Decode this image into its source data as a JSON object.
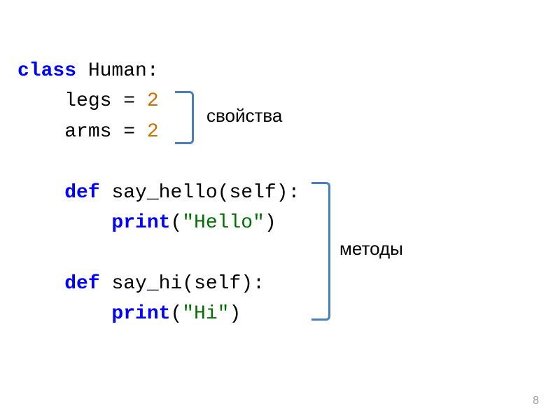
{
  "code": {
    "line1_kw": "class",
    "line1_rest": " Human:",
    "line2_indent": "    ",
    "line2_var": "legs = ",
    "line2_val": "2",
    "line3_indent": "    ",
    "line3_var": "arms = ",
    "line3_val": "2",
    "line4_indent": "    ",
    "line4_kw": "def",
    "line4_rest": " say_hello(self):",
    "line5_indent": "        ",
    "line5_kw": "print",
    "line5_paren_open": "(",
    "line5_str": "\"Hello\"",
    "line5_paren_close": ")",
    "line6_indent": "    ",
    "line6_kw": "def",
    "line6_rest": " say_hi(self):",
    "line7_indent": "        ",
    "line7_kw": "print",
    "line7_paren_open": "(",
    "line7_str": "\"Hi\"",
    "line7_paren_close": ")"
  },
  "annotations": {
    "properties": "свойства",
    "methods": "методы"
  },
  "page_number": "8"
}
